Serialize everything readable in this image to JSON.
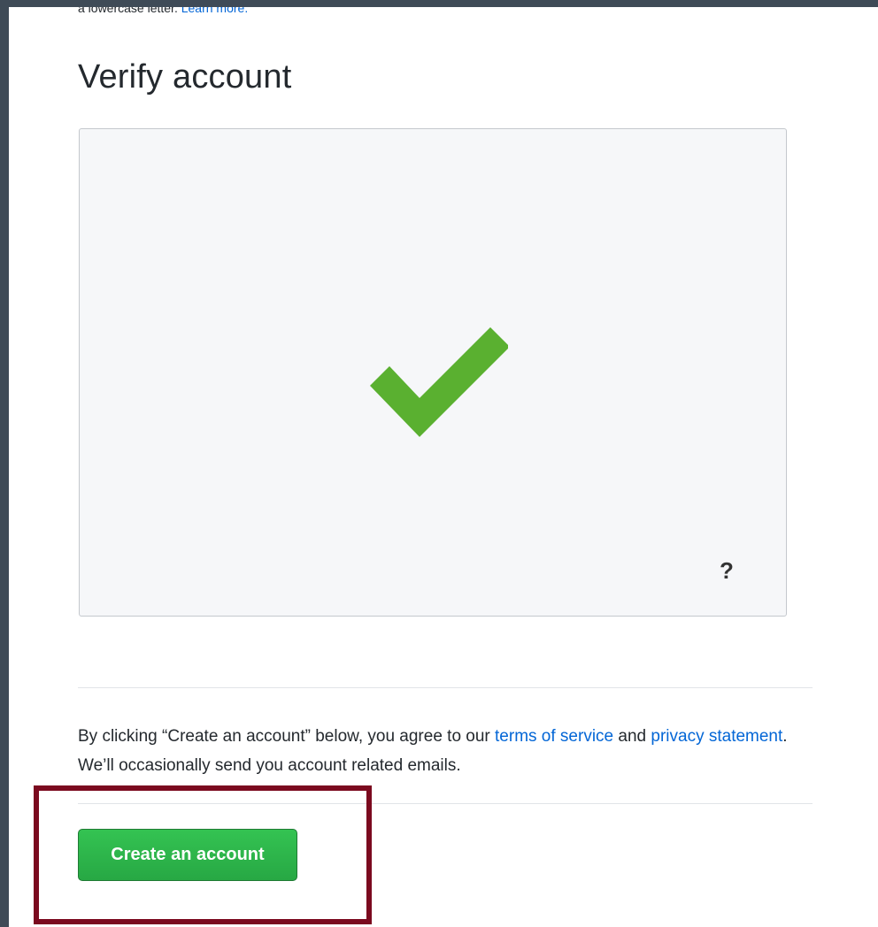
{
  "hint": {
    "text": "a lowercase letter. ",
    "link": "Learn more."
  },
  "verify": {
    "title": "Verify account",
    "status_icon": "checkmark-icon",
    "status_color": "#5ab030",
    "help_label": "?"
  },
  "agreement": {
    "prefix": "By clicking “Create an account” below, you agree to our ",
    "terms_link": "terms of service",
    "middle": " and ",
    "privacy_link": "privacy statement",
    "suffix": ". We’ll occasionally send you account related emails."
  },
  "form": {
    "submit_label": "Create an account"
  },
  "colors": {
    "background": "#3f4b57",
    "link": "#0366d6",
    "button": "#28a745",
    "highlight": "#7b0a1f"
  }
}
